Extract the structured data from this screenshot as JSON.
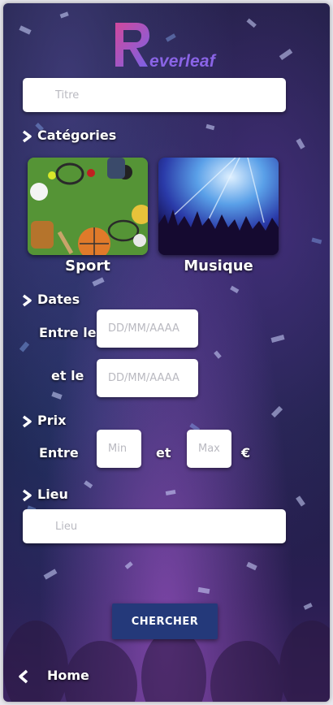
{
  "app": {
    "logo_text": "everleaf",
    "brand_colors": {
      "primary": "#8a64e6",
      "secondary": "#c2489a"
    }
  },
  "search": {
    "title_placeholder": "Titre"
  },
  "categories": {
    "heading": "Catégories",
    "items": [
      {
        "label": "Sport"
      },
      {
        "label": "Musique"
      }
    ]
  },
  "dates": {
    "heading": "Dates",
    "from_label": "Entre le",
    "to_label": "et le",
    "from_placeholder": "DD/MM/AAAA",
    "to_placeholder": "DD/MM/AAAA"
  },
  "price": {
    "heading": "Prix",
    "between_label": "Entre",
    "and_label": "et",
    "min_placeholder": "Min",
    "max_placeholder": "Max",
    "currency": "€"
  },
  "location": {
    "heading": "Lieu",
    "placeholder": "Lieu"
  },
  "actions": {
    "search_label": "CHERCHER",
    "home_label": "Home"
  },
  "icons": {
    "section": "chevron-right-icon",
    "back": "chevron-left-icon"
  },
  "colors": {
    "button_bg": "#24397a",
    "input_bg": "#ffffff"
  }
}
